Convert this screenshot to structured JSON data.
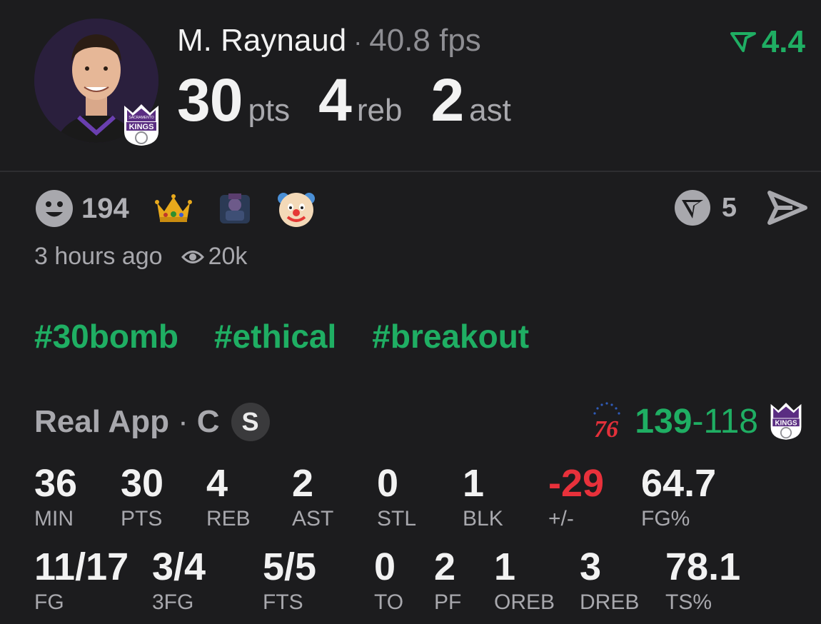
{
  "player": {
    "name": "M. Raynaud",
    "fps": "40.8 fps",
    "team": "Sacramento Kings",
    "team_badge_text": "KINGS",
    "rating": "4.4",
    "rating_color": "#1fae63"
  },
  "headline_stats": [
    {
      "value": "30",
      "unit": "pts"
    },
    {
      "value": "4",
      "unit": "reb"
    },
    {
      "value": "2",
      "unit": "ast"
    }
  ],
  "reactions": {
    "icon": "smiley-face-icon",
    "count": "194",
    "emojis": [
      "crown-icon",
      "custom-sticker-icon",
      "clown-face-icon"
    ]
  },
  "comments": {
    "icon": "v-shield-icon",
    "count": "5"
  },
  "share": {
    "icon": "send-arrow-icon"
  },
  "meta": {
    "time": "3 hours ago",
    "views": "20k"
  },
  "hashtags": [
    "#30bomb",
    "#ethical",
    "#breakout"
  ],
  "game": {
    "source": "Real App",
    "position": "C",
    "starter_badge": "S",
    "opponent": "76ers",
    "opponent_logo_text": "76",
    "team_score": "139",
    "opponent_score": "118",
    "accent": "#1fae63"
  },
  "box_score_row1": [
    {
      "value": "36",
      "label": "MIN"
    },
    {
      "value": "30",
      "label": "PTS"
    },
    {
      "value": "4",
      "label": "REB"
    },
    {
      "value": "2",
      "label": "AST"
    },
    {
      "value": "0",
      "label": "STL"
    },
    {
      "value": "1",
      "label": "BLK"
    },
    {
      "value": "-29",
      "label": "+/-"
    },
    {
      "value": "64.7",
      "label": "FG%"
    }
  ],
  "box_score_row2": [
    {
      "value": "11/17",
      "label": "FG"
    },
    {
      "value": "3/4",
      "label": "3FG"
    },
    {
      "value": "5/5",
      "label": "FTS"
    },
    {
      "value": "0",
      "label": "TO"
    },
    {
      "value": "2",
      "label": "PF"
    },
    {
      "value": "1",
      "label": "OREB"
    },
    {
      "value": "3",
      "label": "DREB"
    },
    {
      "value": "78.1",
      "label": "TS%"
    }
  ]
}
